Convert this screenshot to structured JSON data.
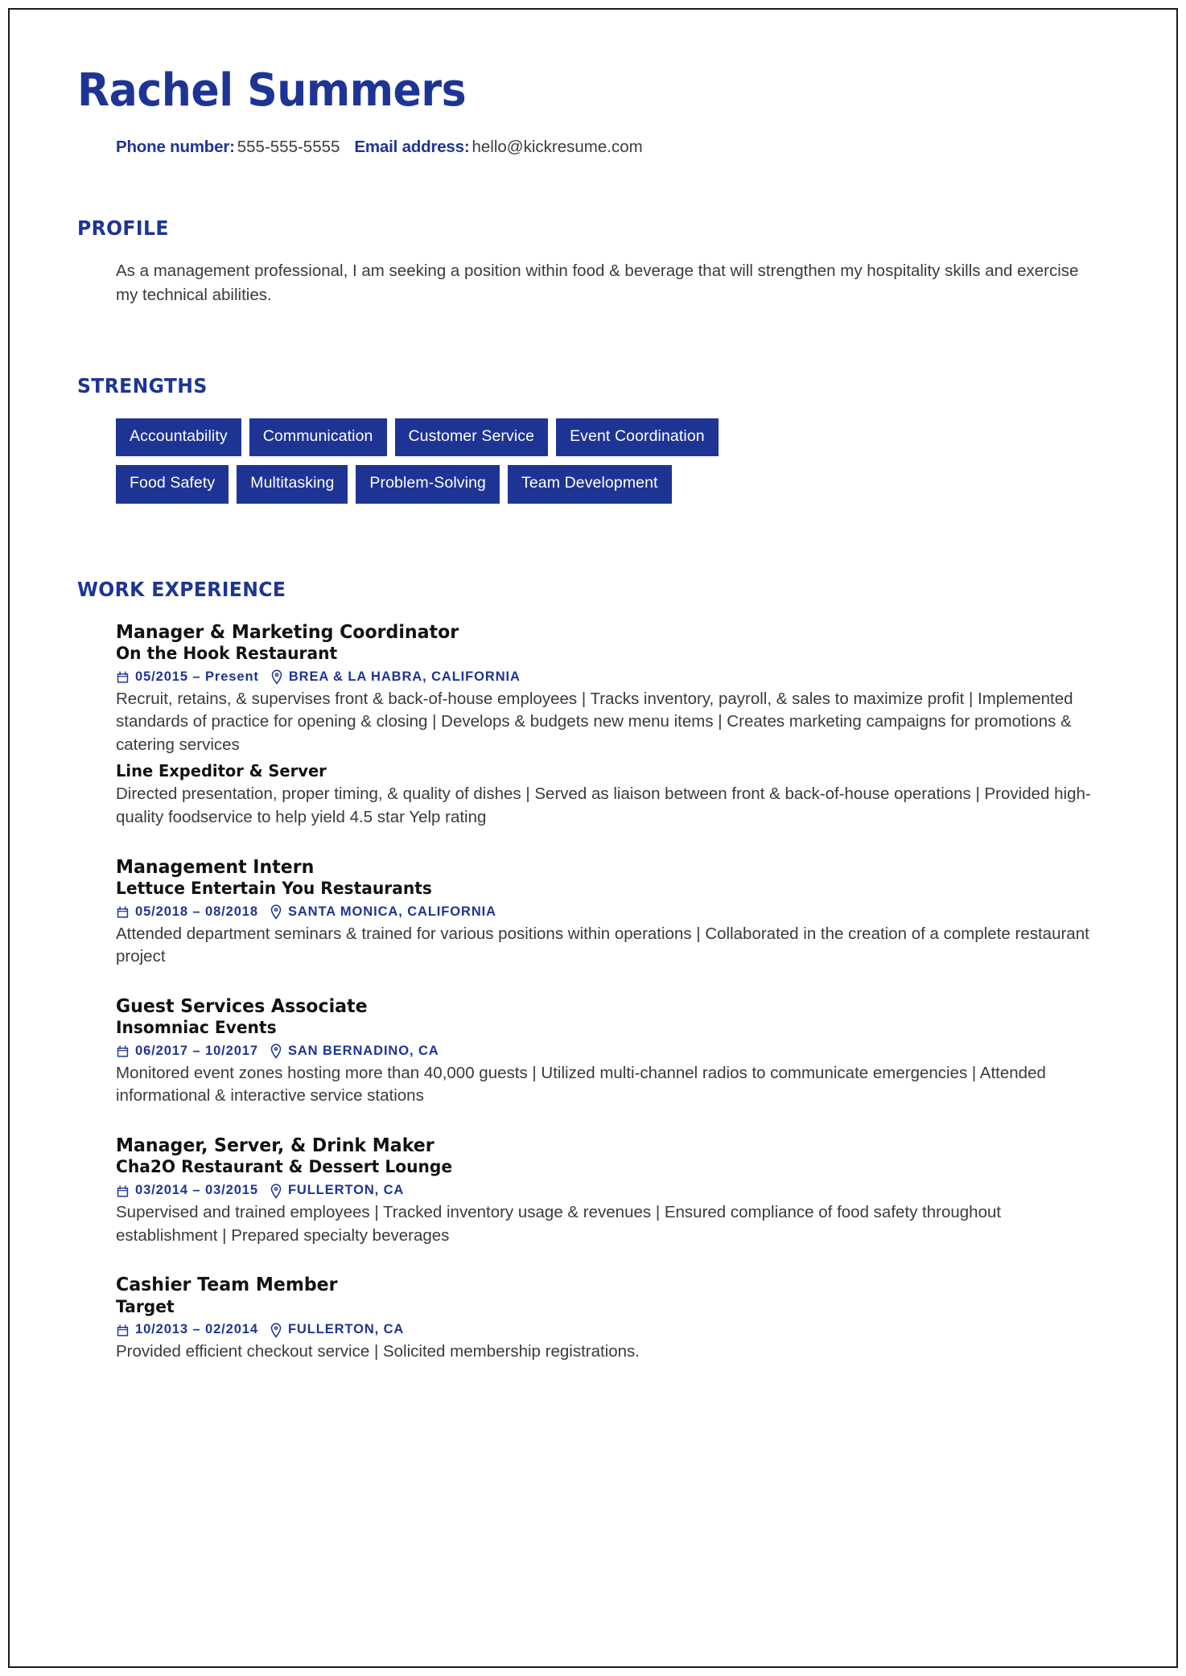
{
  "document": {
    "type": "resume",
    "accent_color": "#1e3495",
    "text_color": "#3b3b3b",
    "heading_color": "#121212",
    "background": "#ffffff"
  },
  "header": {
    "name": "Rachel Summers",
    "phone_label": "Phone number:",
    "phone_value": "555-555-5555",
    "email_label": "Email address:",
    "email_value": "hello@kickresume.com"
  },
  "profile": {
    "heading": "PROFILE",
    "text": "As a management professional, I am seeking a position within food & beverage that will strengthen my hospitality skills and exercise my technical abilities."
  },
  "strengths": {
    "heading": "STRENGTHS",
    "items": [
      "Accountability",
      "Communication",
      "Customer Service",
      "Event Coordination",
      "Food Safety",
      "Multitasking",
      "Problem-Solving",
      "Team Development"
    ]
  },
  "experience": {
    "heading": "WORK EXPERIENCE",
    "calendar_icon": "calendar-icon",
    "location_icon": "location-pin-icon",
    "jobs": [
      {
        "title": "Manager & Marketing Coordinator",
        "company": "On the Hook Restaurant",
        "dates": "05/2015 – Present",
        "location": "BREA & LA HABRA, CALIFORNIA",
        "description": "Recruit, retains, & supervises front & back-of-house employees | Tracks inventory, payroll, & sales to maximize profit | Implemented standards of practice for opening & closing | Develops & budgets new menu items | Creates marketing campaigns for promotions & catering services",
        "sub_title": "Line Expeditor & Server",
        "sub_description": "Directed presentation, proper timing, & quality of dishes | Served as liaison between front & back-of-house operations |  Provided high-quality foodservice to help yield 4.5 star Yelp rating"
      },
      {
        "title": "Management Intern",
        "company": "Lettuce Entertain You Restaurants",
        "dates": "05/2018 – 08/2018",
        "location": "SANTA MONICA, CALIFORNIA",
        "description": "Attended department seminars & trained for various positions within operations | Collaborated in the creation of a complete restaurant project",
        "sub_title": "",
        "sub_description": ""
      },
      {
        "title": "Guest Services Associate",
        "company": "Insomniac Events",
        "dates": "06/2017 – 10/2017",
        "location": "SAN BERNADINO, CA",
        "description": "Monitored event zones hosting more than 40,000 guests | Utilized multi-channel radios to communicate emergencies | Attended informational & interactive service stations",
        "sub_title": "",
        "sub_description": ""
      },
      {
        "title": "Manager, Server, & Drink Maker",
        "company": "Cha2O Restaurant & Dessert Lounge",
        "dates": "03/2014 – 03/2015",
        "location": "FULLERTON, CA",
        "description": "Supervised and trained employees | Tracked inventory usage & revenues | Ensured compliance of food safety throughout establishment | Prepared specialty beverages",
        "sub_title": "",
        "sub_description": ""
      },
      {
        "title": "Cashier Team Member",
        "company": "Target",
        "dates": "10/2013 – 02/2014",
        "location": "FULLERTON, CA",
        "description": "Provided efficient checkout service | Solicited membership registrations.",
        "sub_title": "",
        "sub_description": ""
      }
    ]
  }
}
